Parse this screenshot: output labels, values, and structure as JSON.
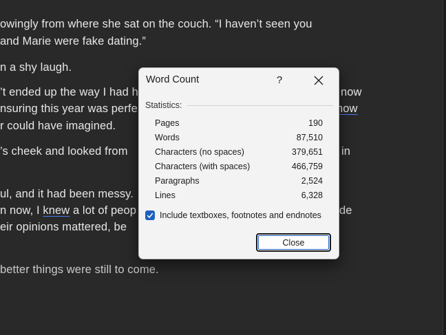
{
  "document": {
    "lines": [
      "owingly from where she sat on the couch. “I haven’t seen you",
      "and Marie were fake dating.”",
      "n a shy laugh.",
      "’t ended up the way I had h",
      "nsuring this year was perfe",
      "r could have imagined.",
      "’s cheek and looked from",
      "ul, and it had been messy.",
      "n now, I ",
      "knew",
      " a lot of peop",
      "eir opinions mattered, be",
      "better things were still to come."
    ],
    "right_fragments": [
      "now",
      "now",
      "in",
      "de"
    ]
  },
  "dialog": {
    "title": "Word Count",
    "help_label": "?",
    "statistics_label": "Statistics:",
    "stats": [
      {
        "label": "Pages",
        "value": "190"
      },
      {
        "label": "Words",
        "value": "87,510"
      },
      {
        "label": "Characters (no spaces)",
        "value": "379,651"
      },
      {
        "label": "Characters (with spaces)",
        "value": "466,759"
      },
      {
        "label": "Paragraphs",
        "value": "2,524"
      },
      {
        "label": "Lines",
        "value": "6,328"
      }
    ],
    "include_label": "Include textboxes, footnotes and endnotes",
    "include_checked": true,
    "close_label": "Close"
  },
  "colors": {
    "background": "#292929",
    "accent": "#1f5fbf"
  }
}
